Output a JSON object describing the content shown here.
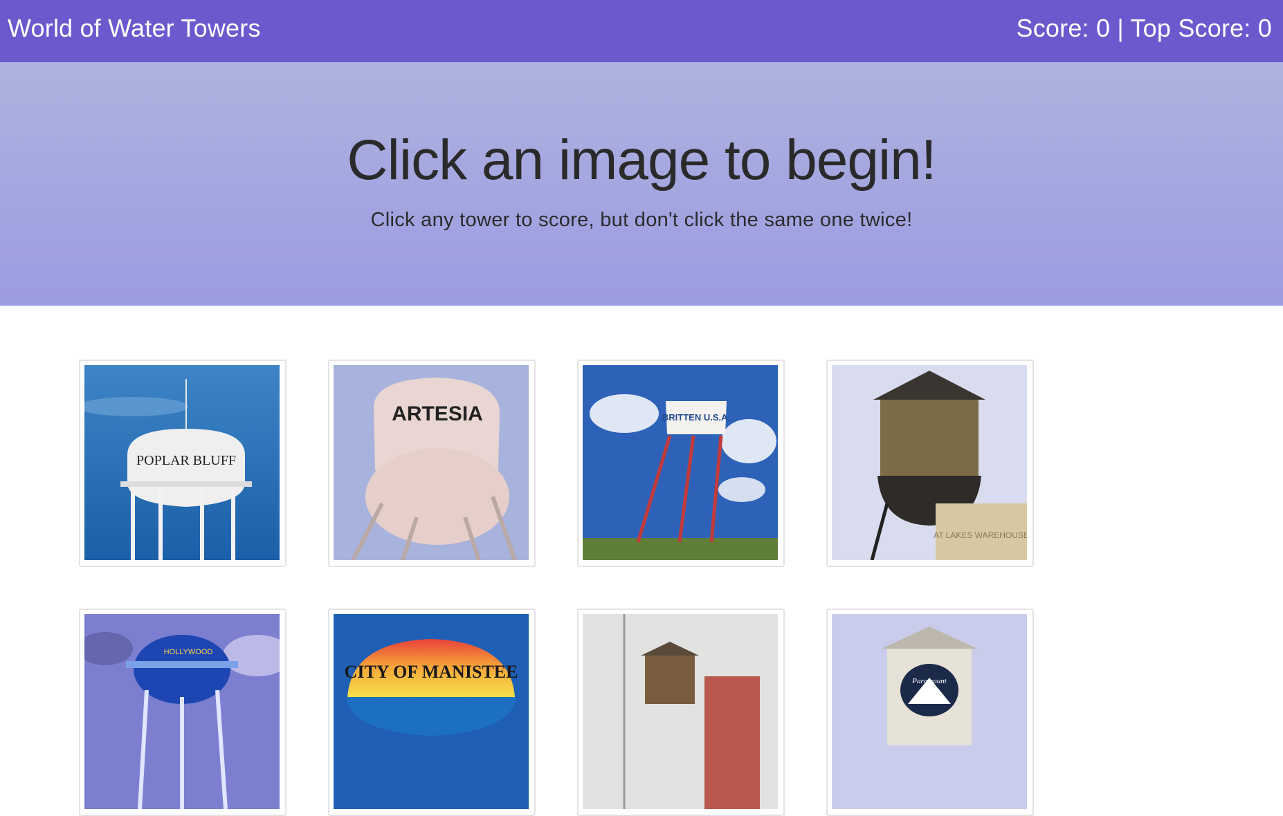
{
  "navbar": {
    "brand": "World of Water Towers",
    "score": "Score: 0 | Top Score: 0"
  },
  "jumbotron": {
    "title": "Click an image to begin!",
    "subtitle": "Click any tower to score, but don't click the same one twice!"
  },
  "colors": {
    "navbar_bg": "#6a5acd",
    "jumbotron_top": "#adb3de",
    "jumbotron_bottom": "#9c9be2"
  },
  "towers": [
    {
      "label": "POPLAR BLUFF"
    },
    {
      "label": "ARTESIA"
    },
    {
      "label": "BRITTEN U.S.A."
    },
    {
      "label": "AT LAKES WAREHOUSE"
    },
    {
      "label": "HOLLYWOOD"
    },
    {
      "label": "CITY OF MANISTEE"
    },
    {
      "label": ""
    },
    {
      "label": "Paramount"
    }
  ]
}
